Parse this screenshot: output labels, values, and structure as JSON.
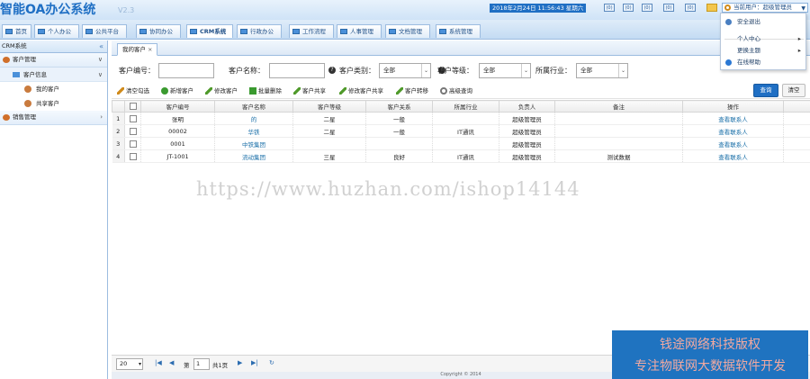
{
  "app": {
    "title": "智能OA办公系统",
    "version": "V2.3"
  },
  "header": {
    "datetime": "2018年2月24日 11:56:43 星期六",
    "icons": [
      "calendar-icon",
      "mail-icon",
      "message-icon",
      "notice-icon",
      "file-icon",
      "lock-icon"
    ],
    "icon_counts": [
      "(0)",
      "(0)",
      "(0)",
      "(0)",
      "(0)",
      ""
    ],
    "user_label": "当前用户：超级管理员"
  },
  "user_menu": {
    "items": [
      "安全退出",
      "个人中心",
      "更换主题",
      "在线帮助"
    ]
  },
  "nav": {
    "tabs": [
      "首页",
      "个人办公",
      "公共平台",
      "协同办公",
      "CRM系统",
      "行政办公",
      "工作流程",
      "人事管理",
      "文档管理",
      "系统管理"
    ],
    "active": 4
  },
  "sidebar": {
    "title": "CRM系统",
    "collapse_symbol": "«",
    "groups": [
      {
        "label": "客户管理",
        "sub": {
          "label": "客户信息",
          "leaves": [
            "我的客户",
            "共享客户"
          ]
        }
      },
      {
        "label": "销售管理"
      }
    ]
  },
  "content_tab": {
    "label": "我的客户",
    "close": "×"
  },
  "filters": {
    "customer_no_label": "客户编号：",
    "customer_name_label": "客户名称：",
    "customer_type_label": "客户类别：",
    "customer_type_value": "全部",
    "customer_level_label": "客户等级：",
    "customer_level_value": "全部",
    "industry_label": "所属行业：",
    "industry_value": "全部"
  },
  "toolbar": {
    "buttons": [
      "清空勾选",
      "新增客户",
      "修改客户",
      "批量删除",
      "客户共享",
      "修改客户共享",
      "客户转移",
      "高级查询"
    ],
    "query": "查询",
    "clear": "清空"
  },
  "table": {
    "columns": [
      "客户编号",
      "客户名称",
      "客户等级",
      "客户关系",
      "所属行业",
      "负责人",
      "备注",
      "操作"
    ],
    "rows": [
      {
        "n": "1",
        "no": "张明",
        "name": "的",
        "level": "二星",
        "rel": "一般",
        "industry": "",
        "owner": "超级管理员",
        "note": "",
        "op": "查看联系人"
      },
      {
        "n": "2",
        "no": "00002",
        "name": "华铁",
        "level": "二星",
        "rel": "一般",
        "industry": "IT通讯",
        "owner": "超级管理员",
        "note": "",
        "op": "查看联系人"
      },
      {
        "n": "3",
        "no": "0001",
        "name": "中铁集团",
        "level": "",
        "rel": "",
        "industry": "",
        "owner": "超级管理员",
        "note": "",
        "op": "查看联系人"
      },
      {
        "n": "4",
        "no": "JT-1001",
        "name": "流动集团",
        "level": "三星",
        "rel": "良好",
        "industry": "IT通讯",
        "owner": "超级管理员",
        "note": "测试数据",
        "op": "查看联系人"
      }
    ]
  },
  "pager": {
    "page_size": "20",
    "page_label_pre": "第",
    "page": "1",
    "page_label_post": "共1页"
  },
  "footer": {
    "copyright": "Copyright © 2014"
  },
  "watermark": "https://www.huzhan.com/ishop14144",
  "badge": {
    "line1": "钱途网络科技版权",
    "line2": "专注物联网大数据软件开发"
  }
}
